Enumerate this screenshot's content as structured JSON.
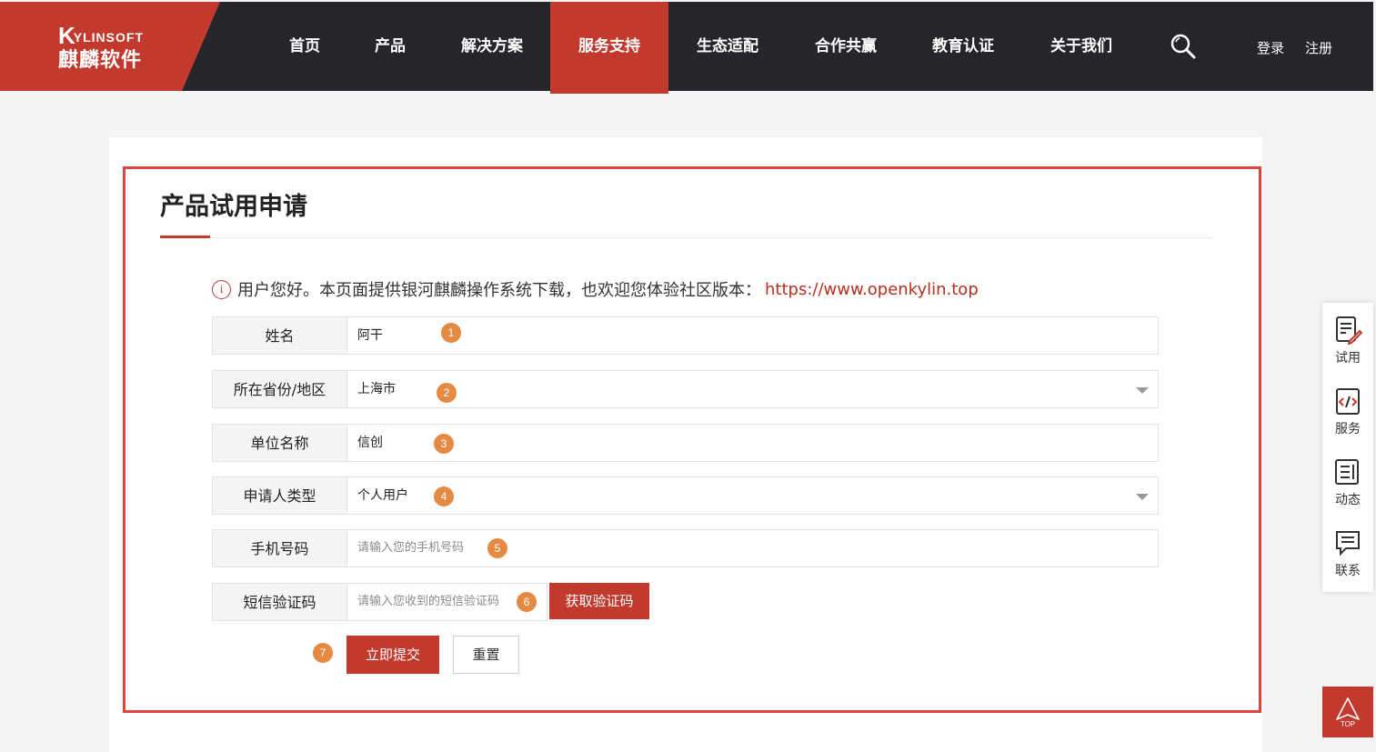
{
  "header": {
    "logo_en": "YLINSOFT",
    "logo_k": "K",
    "logo_cn": "麒麟软件",
    "nav": [
      "首页",
      "产品",
      "解决方案",
      "服务支持",
      "生态适配",
      "合作共赢",
      "教育认证",
      "关于我们"
    ],
    "active_nav": "服务支持",
    "login": "登录",
    "register": "注册"
  },
  "form": {
    "title": "产品试用申请",
    "notice_text": "用户您好。本页面提供银河麒麟操作系统下载，也欢迎您体验社区版本：",
    "notice_link": "https://www.openkylin.top",
    "info_icon": "i",
    "fields": [
      {
        "label": "姓名",
        "value": "阿干",
        "badge": "1"
      },
      {
        "label": "所在省份/地区",
        "value": "上海市",
        "badge": "2"
      },
      {
        "label": "单位名称",
        "value": "信创",
        "badge": "3"
      },
      {
        "label": "申请人类型",
        "value": "个人用户",
        "badge": "4"
      },
      {
        "label": "手机号码",
        "placeholder": "请输入您的手机号码",
        "badge": "5"
      },
      {
        "label": "短信验证码",
        "placeholder": "请输入您收到的短信验证码",
        "badge": "6"
      }
    ],
    "get_code": "获取验证码",
    "submit": "立即提交",
    "submit_badge": "7",
    "reset": "重置"
  },
  "sidebar": {
    "items": [
      "试用",
      "服务",
      "动态",
      "联系"
    ],
    "top": "TOP"
  },
  "colors": {
    "brand_red": "#c23a2d",
    "header_bg": "#26262a",
    "badge_orange": "#e58a43",
    "frame_red": "#e0423e"
  }
}
